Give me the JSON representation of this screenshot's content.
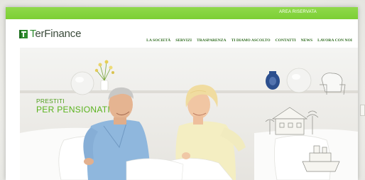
{
  "topbar": {
    "reserved_area": "AREA RISERVATA",
    "color": "#7fd03a"
  },
  "logo": {
    "text_prefix": "T",
    "text_rest": "erFinance",
    "icon": "terfinance-logo-icon"
  },
  "nav": {
    "items": [
      "LA SOCIETÀ",
      "SERVIZI",
      "TRASPARENZA",
      "TI DIAMO ASCOLTO",
      "CONTATTI",
      "NEWS",
      "LAVORA CON NOI"
    ]
  },
  "hero": {
    "title_line1": "PRESTITI",
    "title_line2": "PER PENSIONATI",
    "accent": "#5ab31e"
  }
}
